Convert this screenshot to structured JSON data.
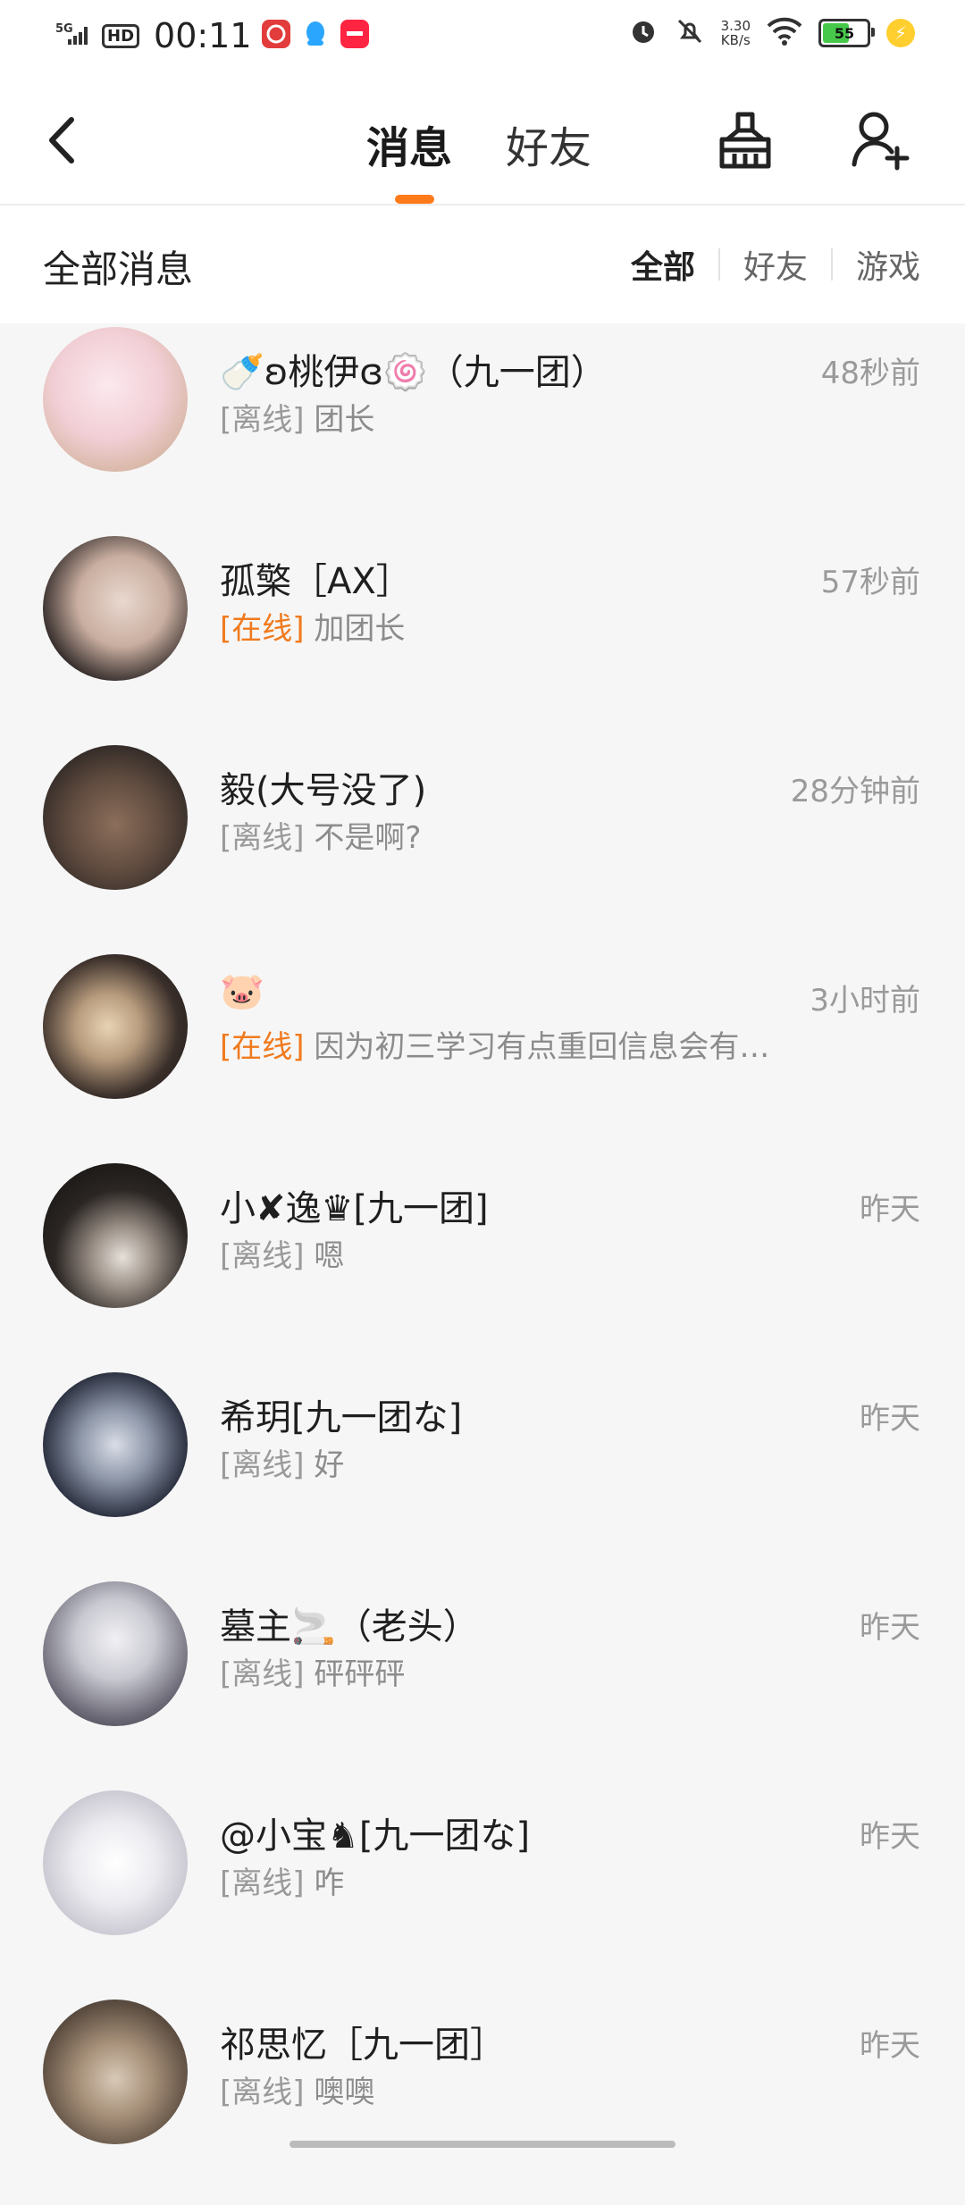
{
  "status_bar": {
    "network": "5G",
    "hd": "HD",
    "time": "00:11",
    "speed_value": "3.30",
    "speed_unit": "KB/s",
    "battery": "55"
  },
  "header": {
    "tab_messages": "消息",
    "tab_friends": "好友",
    "accent_color": "#ff7a1a"
  },
  "filter": {
    "title": "全部消息",
    "tabs": [
      "全部",
      "好友",
      "游戏"
    ]
  },
  "conversations": [
    {
      "name": "🍼ʚ桃伊ɞ🍥（九一团）",
      "time": "48秒前",
      "status": "[离线]",
      "message": "团长",
      "online": false
    },
    {
      "name": "孤檠［AX］",
      "time": "57秒前",
      "status": "[在线]",
      "message": "加团长",
      "online": true
    },
    {
      "name": "毅(大号没了)",
      "time": "28分钟前",
      "status": "[离线]",
      "message": "不是啊?",
      "online": false
    },
    {
      "name": "🐷",
      "time": "3小时前",
      "status": "[在线]",
      "message": "因为初三学习有点重回信息会有…",
      "online": true
    },
    {
      "name": "小✘逸♛[九一团]",
      "time": "昨天",
      "status": "[离线]",
      "message": "嗯",
      "online": false
    },
    {
      "name": "希玥[九一团な]",
      "time": "昨天",
      "status": "[离线]",
      "message": "好",
      "online": false
    },
    {
      "name": "墓主🚬（老头）",
      "time": "昨天",
      "status": "[离线]",
      "message": "砰砰砰",
      "online": false
    },
    {
      "name": "@小宝♞[九一团な]",
      "time": "昨天",
      "status": "[离线]",
      "message": "咋",
      "online": false
    },
    {
      "name": "祁思忆［九一团］",
      "time": "昨天",
      "status": "[离线]",
      "message": "噢噢",
      "online": false
    }
  ]
}
